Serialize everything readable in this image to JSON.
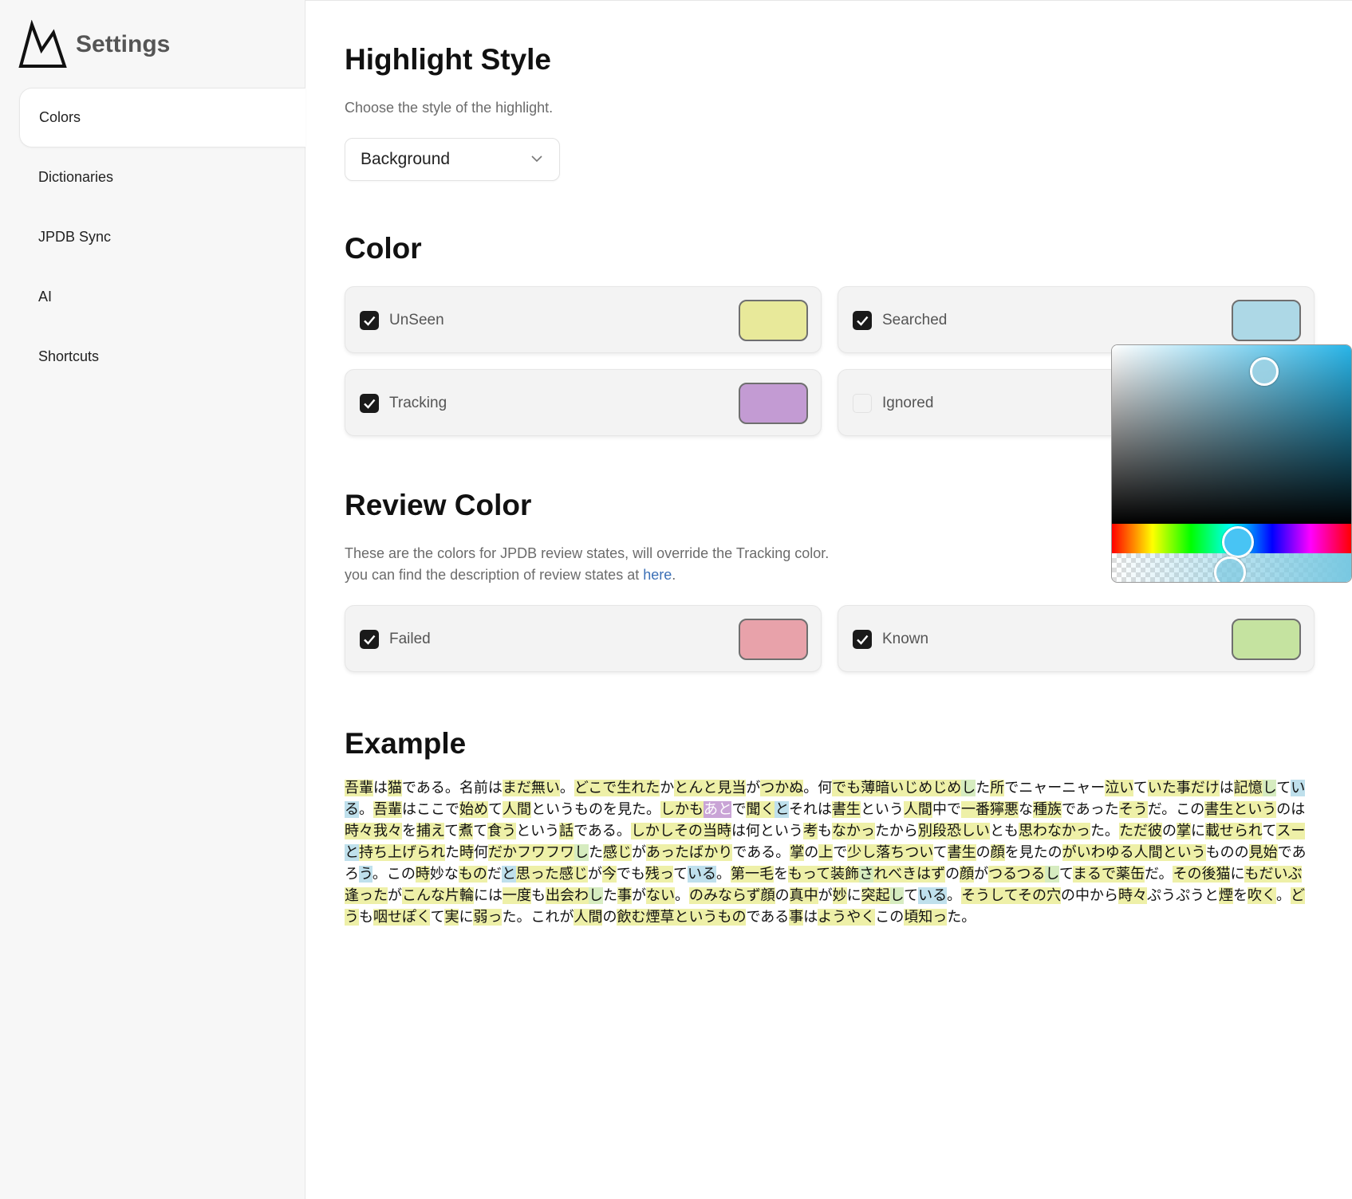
{
  "app": {
    "title": "Settings",
    "logo_icon": "mountain-logo-icon"
  },
  "sidebar": {
    "items": [
      {
        "label": "Colors",
        "active": true
      },
      {
        "label": "Dictionaries",
        "active": false
      },
      {
        "label": "JPDB Sync",
        "active": false
      },
      {
        "label": "AI",
        "active": false
      },
      {
        "label": "Shortcuts",
        "active": false
      }
    ]
  },
  "highlight_style": {
    "title": "Highlight Style",
    "description": "Choose the style of the highlight.",
    "selected": "Background"
  },
  "color_section": {
    "title": "Color",
    "cards": [
      {
        "label": "UnSeen",
        "checked": true,
        "color": "#e8e99a"
      },
      {
        "label": "Searched",
        "checked": true,
        "color": "#add8e6"
      },
      {
        "label": "Tracking",
        "checked": true,
        "color": "#c39bd3"
      },
      {
        "label": "Ignored",
        "checked": false,
        "color": ""
      }
    ]
  },
  "review_color": {
    "title": "Review Color",
    "description_line1": "These are the colors for JPDB review states, will override the Tracking color.",
    "description_line2_prefix": "you can find the description of review states at ",
    "link_text": "here",
    "description_line2_suffix": ".",
    "cards": [
      {
        "label": "Failed",
        "checked": true,
        "color": "#e8a2aa"
      },
      {
        "label": "Known",
        "checked": true,
        "color": "#c5e3a0"
      }
    ]
  },
  "example": {
    "title": "Example",
    "colors": {
      "u": "#eef0a8",
      "k": "#d6ecc0",
      "s": "#bfe0ec",
      "t": "#c9a4d6"
    },
    "segments": [
      [
        "u",
        "吾輩"
      ],
      [
        "",
        "は"
      ],
      [
        "u",
        "猫"
      ],
      [
        "",
        "である。名前は"
      ],
      [
        "u",
        "まだ"
      ],
      [
        "u",
        "無い"
      ],
      [
        "",
        "。"
      ],
      [
        "u",
        "どこで"
      ],
      [
        "u",
        "生れた"
      ],
      [
        "",
        "か"
      ],
      [
        "u",
        "とんと"
      ],
      [
        "u",
        "見当"
      ],
      [
        "",
        "が"
      ],
      [
        "u",
        "つかぬ"
      ],
      [
        "",
        "。何"
      ],
      [
        "u",
        "でも"
      ],
      [
        "u",
        "薄暗い"
      ],
      [
        "u",
        "じめじめ"
      ],
      [
        "k",
        "し"
      ],
      [
        "",
        "た"
      ],
      [
        "u",
        "所"
      ],
      [
        "",
        "でニャーニャー"
      ],
      [
        "u",
        "泣い"
      ],
      [
        "",
        "て"
      ],
      [
        "u",
        "いた"
      ],
      [
        "u",
        "事"
      ],
      [
        "u",
        "だけ"
      ],
      [
        "",
        "は"
      ],
      [
        "u",
        "記憶"
      ],
      [
        "k",
        "し"
      ],
      [
        "",
        "て"
      ],
      [
        "s",
        "いる"
      ],
      [
        "",
        "。"
      ],
      [
        "u",
        "吾輩"
      ],
      [
        "",
        "はここで"
      ],
      [
        "u",
        "始め"
      ],
      [
        "",
        "て"
      ],
      [
        "u",
        "人間"
      ],
      [
        "",
        "というものを見た。"
      ],
      [
        "u",
        "しかも"
      ],
      [
        "t",
        "あと"
      ],
      [
        "",
        "で"
      ],
      [
        "u",
        "聞く"
      ],
      [
        "s",
        "と"
      ],
      [
        "",
        "それは"
      ],
      [
        "u",
        "書生"
      ],
      [
        "",
        "という"
      ],
      [
        "u",
        "人間"
      ],
      [
        "",
        "中で"
      ],
      [
        "u",
        "一番"
      ],
      [
        "u",
        "獰悪"
      ],
      [
        "",
        "な"
      ],
      [
        "u",
        "種族"
      ],
      [
        "",
        "であった"
      ],
      [
        "u",
        "そう"
      ],
      [
        "",
        "だ。この"
      ],
      [
        "u",
        "書生"
      ],
      [
        "u",
        "という"
      ],
      [
        "",
        "のは"
      ],
      [
        "u",
        "時々"
      ],
      [
        "u",
        "我々"
      ],
      [
        "",
        "を"
      ],
      [
        "u",
        "捕え"
      ],
      [
        "",
        "て"
      ],
      [
        "u",
        "煮"
      ],
      [
        "",
        "て"
      ],
      [
        "u",
        "食う"
      ],
      [
        "",
        "という"
      ],
      [
        "u",
        "話"
      ],
      [
        "",
        "である。"
      ],
      [
        "u",
        "しかし"
      ],
      [
        "u",
        "その"
      ],
      [
        "u",
        "当時"
      ],
      [
        "",
        "は何という"
      ],
      [
        "u",
        "考"
      ],
      [
        "",
        "も"
      ],
      [
        "u",
        "なかっ"
      ],
      [
        "",
        "たから"
      ],
      [
        "u",
        "別段"
      ],
      [
        "u",
        "恐しい"
      ],
      [
        "",
        "とも"
      ],
      [
        "u",
        "思わ"
      ],
      [
        "u",
        "なかっ"
      ],
      [
        "",
        "た。"
      ],
      [
        "u",
        "ただ"
      ],
      [
        "u",
        "彼"
      ],
      [
        "",
        "の"
      ],
      [
        "u",
        "掌"
      ],
      [
        "",
        "に"
      ],
      [
        "u",
        "載せ"
      ],
      [
        "u",
        "られ"
      ],
      [
        "",
        "て"
      ],
      [
        "u",
        "スー"
      ],
      [
        "s",
        "と"
      ],
      [
        "u",
        "持ち上げ"
      ],
      [
        "u",
        "られ"
      ],
      [
        "",
        "た"
      ],
      [
        "u",
        "時"
      ],
      [
        "",
        "何"
      ],
      [
        "u",
        "だか"
      ],
      [
        "u",
        "フワフワ"
      ],
      [
        "k",
        "し"
      ],
      [
        "",
        "た"
      ],
      [
        "u",
        "感じ"
      ],
      [
        "",
        "が"
      ],
      [
        "u",
        "あった"
      ],
      [
        "u",
        "ばかり"
      ],
      [
        "",
        "である。"
      ],
      [
        "u",
        "掌"
      ],
      [
        "",
        "の"
      ],
      [
        "u",
        "上"
      ],
      [
        "",
        "で"
      ],
      [
        "u",
        "少し"
      ],
      [
        "u",
        "落ちつい"
      ],
      [
        "",
        "て"
      ],
      [
        "u",
        "書生"
      ],
      [
        "",
        "の"
      ],
      [
        "u",
        "顔"
      ],
      [
        "",
        "を見たの"
      ],
      [
        "u",
        "が"
      ],
      [
        "u",
        "いわゆる"
      ],
      [
        "u",
        "人間"
      ],
      [
        "u",
        "という"
      ],
      [
        "",
        "ものの"
      ],
      [
        "u",
        "見始"
      ],
      [
        "",
        "であ"
      ],
      [
        "",
        "ろ"
      ],
      [
        "s",
        "う"
      ],
      [
        "",
        "。この"
      ],
      [
        "u",
        "時"
      ],
      [
        "",
        "妙"
      ],
      [
        "",
        "な"
      ],
      [
        "u",
        "もの"
      ],
      [
        "",
        "だ"
      ],
      [
        "s",
        "と"
      ],
      [
        "u",
        "思った"
      ],
      [
        "u",
        "感じ"
      ],
      [
        "",
        "が"
      ],
      [
        "u",
        "今"
      ],
      [
        "",
        "でも"
      ],
      [
        "u",
        "残っ"
      ],
      [
        "",
        "て"
      ],
      [
        "s",
        "いる"
      ],
      [
        "",
        "。"
      ],
      [
        "u",
        "第一"
      ],
      [
        "u",
        "毛"
      ],
      [
        "",
        "を"
      ],
      [
        "u",
        "もって"
      ],
      [
        "u",
        "装飾"
      ],
      [
        "k",
        "さ"
      ],
      [
        "u",
        "れ"
      ],
      [
        "u",
        "べき"
      ],
      [
        "u",
        "はず"
      ],
      [
        "",
        "の"
      ],
      [
        "u",
        "顔"
      ],
      [
        "",
        "が"
      ],
      [
        "u",
        "つるつる"
      ],
      [
        "k",
        "し"
      ],
      [
        "",
        "て"
      ],
      [
        "u",
        "まるで"
      ],
      [
        "u",
        "薬缶"
      ],
      [
        "",
        "だ。"
      ],
      [
        "u",
        "その"
      ],
      [
        "u",
        "後"
      ],
      [
        "u",
        "猫"
      ],
      [
        "",
        "に"
      ],
      [
        "u",
        "も"
      ],
      [
        "u",
        "だいぶ"
      ],
      [
        "u",
        "逢った"
      ],
      [
        "",
        "が"
      ],
      [
        "u",
        "こんな"
      ],
      [
        "u",
        "片輪"
      ],
      [
        "",
        "には"
      ],
      [
        "u",
        "一度"
      ],
      [
        "",
        "も"
      ],
      [
        "u",
        "出会わ"
      ],
      [
        "k",
        "し"
      ],
      [
        "",
        "た"
      ],
      [
        "u",
        "事"
      ],
      [
        "",
        "が"
      ],
      [
        "u",
        "ない"
      ],
      [
        "",
        "。"
      ],
      [
        "u",
        "のみならず"
      ],
      [
        "u",
        "顔"
      ],
      [
        "",
        "の"
      ],
      [
        "u",
        "真中"
      ],
      [
        "",
        "が"
      ],
      [
        "u",
        "妙"
      ],
      [
        "",
        "に"
      ],
      [
        "u",
        "突起"
      ],
      [
        "k",
        "し"
      ],
      [
        "",
        "て"
      ],
      [
        "s",
        "いる"
      ],
      [
        "",
        "。"
      ],
      [
        "u",
        "そうして"
      ],
      [
        "u",
        "その"
      ],
      [
        "u",
        "穴"
      ],
      [
        "",
        "の中から"
      ],
      [
        "u",
        "時々"
      ],
      [
        "",
        "ぷうぷうと"
      ],
      [
        "u",
        "煙"
      ],
      [
        "",
        "を"
      ],
      [
        "u",
        "吹く"
      ],
      [
        "",
        "。"
      ],
      [
        "u",
        "ど"
      ],
      [
        "u",
        "う"
      ],
      [
        "",
        "も"
      ],
      [
        "u",
        "咽せ"
      ],
      [
        "u",
        "ぽく"
      ],
      [
        "",
        "て"
      ],
      [
        "u",
        "実"
      ],
      [
        "",
        "に"
      ],
      [
        "u",
        "弱っ"
      ],
      [
        "",
        "た。これが"
      ],
      [
        "u",
        "人間"
      ],
      [
        "",
        "の"
      ],
      [
        "u",
        "飲む"
      ],
      [
        "u",
        "煙草"
      ],
      [
        "u",
        "という"
      ],
      [
        "u",
        "もの"
      ],
      [
        "",
        "である"
      ],
      [
        "u",
        "事"
      ],
      [
        "",
        "は"
      ],
      [
        "u",
        "ようやく"
      ],
      [
        "",
        "この"
      ],
      [
        "u",
        "頃"
      ],
      [
        "u",
        "知っ"
      ],
      [
        "",
        "た。"
      ]
    ]
  },
  "color_picker": {
    "target": "Searched",
    "hue_color": "#29b5e8"
  },
  "icons": {
    "checkbox": "check-icon",
    "dropdown": "chevron-down-icon"
  }
}
